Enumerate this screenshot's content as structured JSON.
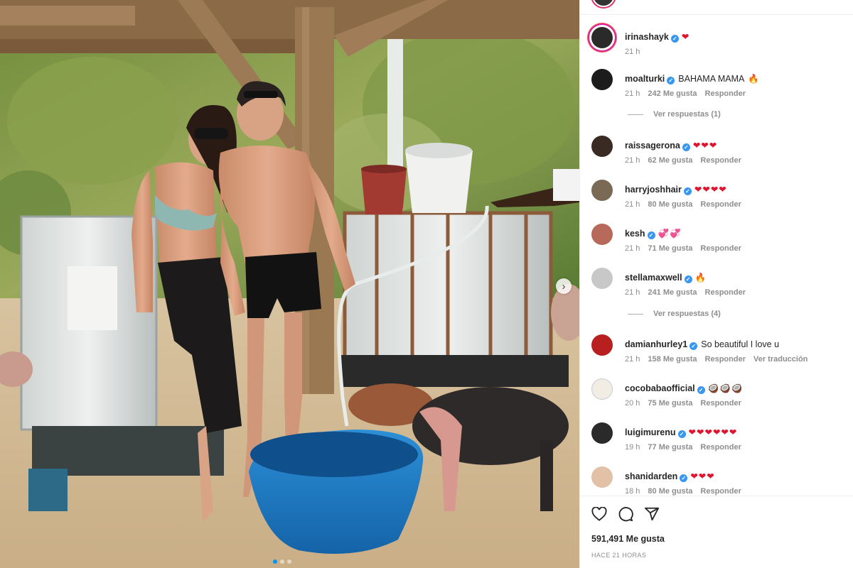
{
  "post": {
    "author": "irinashayk",
    "caption": "❤",
    "time": "21 h"
  },
  "comments": [
    {
      "user": "moalturki",
      "text": "BAHAMA MAMA",
      "emoji": "🔥",
      "time": "21 h",
      "likes": "242 Me gusta",
      "reply": "Responder",
      "view_replies": "Ver respuestas (1)"
    },
    {
      "user": "raissagerona",
      "text": "",
      "emoji": "❤❤❤",
      "time": "21 h",
      "likes": "62 Me gusta",
      "reply": "Responder"
    },
    {
      "user": "harryjoshhair",
      "text": "",
      "emoji": "❤❤❤❤",
      "time": "21 h",
      "likes": "80 Me gusta",
      "reply": "Responder"
    },
    {
      "user": "kesh",
      "text": "",
      "emoji": "💞💞",
      "time": "21 h",
      "likes": "71 Me gusta",
      "reply": "Responder"
    },
    {
      "user": "stellamaxwell",
      "text": "",
      "emoji": "🔥",
      "time": "21 h",
      "likes": "241 Me gusta",
      "reply": "Responder",
      "view_replies": "Ver respuestas (4)"
    },
    {
      "user": "damianhurley1",
      "text": "So beautiful I love u",
      "emoji": "",
      "time": "21 h",
      "likes": "158 Me gusta",
      "reply": "Responder",
      "translate": "Ver traducción"
    },
    {
      "user": "cocobabaofficial",
      "text": "",
      "emoji": "🥥🥥🥥",
      "time": "20 h",
      "likes": "75 Me gusta",
      "reply": "Responder"
    },
    {
      "user": "luigimurenu",
      "text": "",
      "emoji": "❤❤❤❤❤❤",
      "time": "19 h",
      "likes": "77 Me gusta",
      "reply": "Responder"
    },
    {
      "user": "shanidarden",
      "text": "",
      "emoji": "❤❤❤",
      "time": "18 h",
      "likes": "80 Me gusta",
      "reply": "Responder"
    }
  ],
  "footer": {
    "likes": "591,491 Me gusta",
    "timestamp": "HACE 21 HORAS"
  },
  "icons": {
    "verified": "verified-badge-icon",
    "like": "heart-icon",
    "comment": "comment-icon",
    "share": "paper-plane-icon",
    "next": "chevron-right-icon"
  }
}
